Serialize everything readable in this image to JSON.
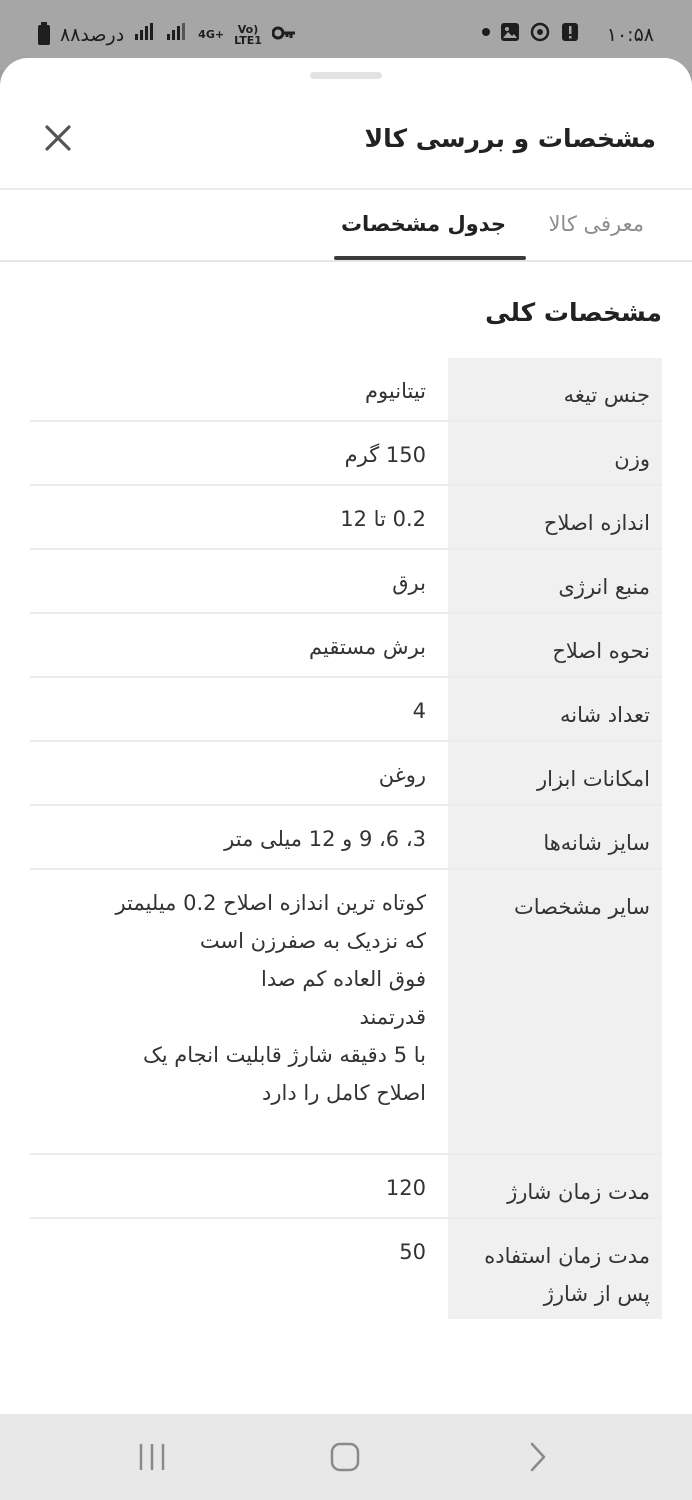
{
  "status_bar": {
    "time": "۱۰:۵۸",
    "battery_text": "۸۸درصد",
    "network_type": "4G+",
    "volte_top": "Vo)",
    "volte_bottom": "LTE1"
  },
  "sheet": {
    "title": "مشخصات و بررسی کالا",
    "tabs": [
      {
        "label": "معرفی کالا",
        "active": false
      },
      {
        "label": "جدول مشخصات",
        "active": true
      }
    ],
    "section_title": "مشخصات کلی",
    "specs": [
      {
        "key": "جنس تیغه",
        "values": [
          "تیتانیوم"
        ]
      },
      {
        "key": "وزن",
        "values": [
          "150 گرم"
        ]
      },
      {
        "key": "اندازه اصلاح",
        "values": [
          "0.2 تا 12"
        ]
      },
      {
        "key": "منبع انرژی",
        "values": [
          "برق"
        ]
      },
      {
        "key": "نحوه اصلاح",
        "values": [
          "برش مستقیم"
        ]
      },
      {
        "key": "تعداد شانه",
        "values": [
          "4"
        ]
      },
      {
        "key": "امکانات ابزار",
        "values": [
          "روغن"
        ]
      },
      {
        "key": "سایز شانه‌ها",
        "values": [
          "3، 6، 9 و 12 میلی متر"
        ]
      },
      {
        "key": "سایر مشخصات",
        "values": [
          "کوتاه ترین اندازه اصلاح 0.2 میلیمتر",
          "که نزدیک به صفرزن است",
          "فوق العاده کم صدا",
          "قدرتمند",
          "با 5 دقیقه شارژ قابلیت انجام یک",
          "اصلاح کامل را دارد"
        ]
      },
      {
        "key": "مدت زمان شارژ",
        "values": [
          "120"
        ]
      },
      {
        "key": "مدت زمان استفاده پس از شارژ",
        "values": [
          "50"
        ]
      }
    ]
  },
  "icons": {
    "close": "close-icon",
    "back": "back-icon",
    "home": "home-icon",
    "recents": "recents-icon"
  },
  "colors": {
    "active_tab": "#222222",
    "inactive_tab": "#8d8d8d",
    "key_cell_bg": "#f0f0f0"
  }
}
